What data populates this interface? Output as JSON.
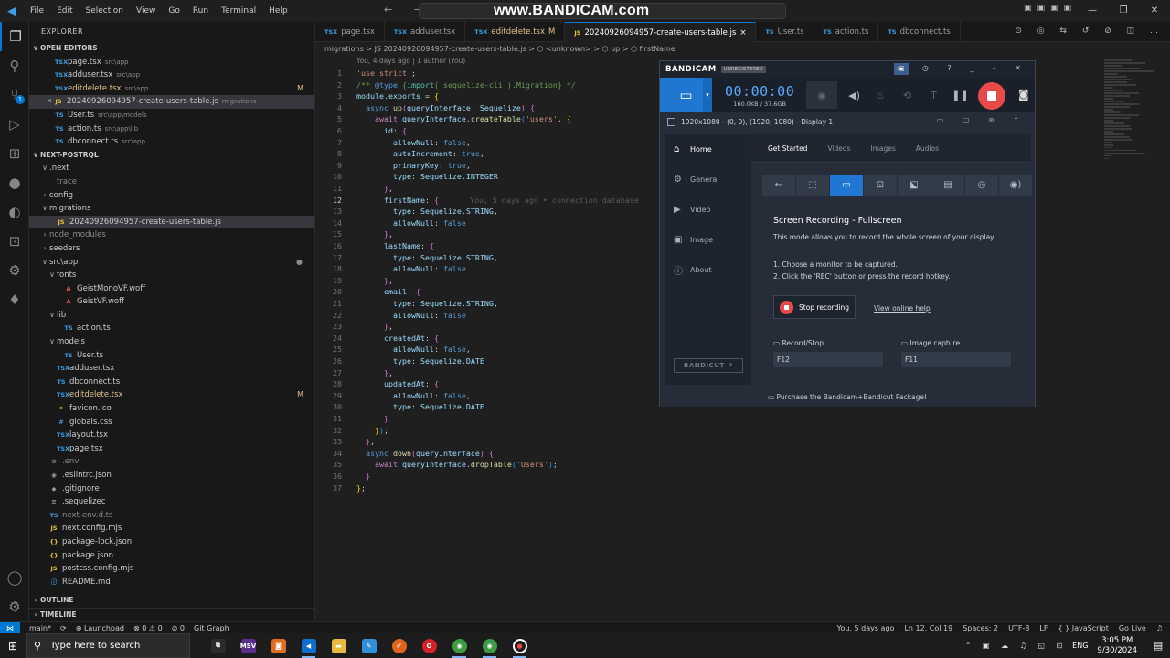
{
  "titlebar": {
    "menu": [
      "File",
      "Edit",
      "Selection",
      "View",
      "Go",
      "Run",
      "Terminal",
      "Help"
    ],
    "watermark": "www.BANDICAM.com"
  },
  "explorer": {
    "title": "EXPLORER",
    "open_editors_label": "OPEN EDITORS",
    "open_editors": [
      {
        "icon": "TSX",
        "name": "page.tsx",
        "desc": "src\\app",
        "modified": ""
      },
      {
        "icon": "TSX",
        "name": "adduser.tsx",
        "desc": "src\\app",
        "modified": ""
      },
      {
        "icon": "TSX",
        "name": "editdelete.tsx",
        "desc": "src\\app",
        "modified": "M"
      },
      {
        "icon": "JS",
        "name": "20240926094957-create-users-table.js",
        "desc": "migrations",
        "modified": ""
      },
      {
        "icon": "TS",
        "name": "User.ts",
        "desc": "src\\app\\models",
        "modified": ""
      },
      {
        "icon": "TS",
        "name": "action.ts",
        "desc": "src\\app\\lib",
        "modified": ""
      },
      {
        "icon": "TS",
        "name": "dbconnect.ts",
        "desc": "src\\app",
        "modified": ""
      }
    ],
    "project_label": "NEXT-POSTRQL",
    "tree": [
      {
        "name": ".next",
        "twisty": "v",
        "icon": "",
        "depth": 1
      },
      {
        "name": "trace",
        "twisty": "",
        "icon": "",
        "depth": 2
      },
      {
        "name": "config",
        "twisty": ">",
        "icon": "",
        "depth": 1
      },
      {
        "name": "migrations",
        "twisty": "v",
        "icon": "",
        "depth": 1
      },
      {
        "name": "20240926094957-create-users-table.js",
        "twisty": "",
        "icon": "JS",
        "depth": 2
      },
      {
        "name": "node_modules",
        "twisty": ">",
        "icon": "",
        "depth": 1
      },
      {
        "name": "seeders",
        "twisty": ">",
        "icon": "",
        "depth": 1
      },
      {
        "name": "src\\app",
        "twisty": "v",
        "icon": "",
        "depth": 1
      },
      {
        "name": "fonts",
        "twisty": "v",
        "icon": "",
        "depth": 2
      },
      {
        "name": "GeistMonoVF.woff",
        "twisty": "",
        "icon": "A",
        "depth": 3
      },
      {
        "name": "GeistVF.woff",
        "twisty": "",
        "icon": "A",
        "depth": 3
      },
      {
        "name": "lib",
        "twisty": "v",
        "icon": "",
        "depth": 2
      },
      {
        "name": "action.ts",
        "twisty": "",
        "icon": "TS",
        "depth": 3
      },
      {
        "name": "models",
        "twisty": "v",
        "icon": "",
        "depth": 2
      },
      {
        "name": "User.ts",
        "twisty": "",
        "icon": "TS",
        "depth": 3
      },
      {
        "name": "adduser.tsx",
        "twisty": "",
        "icon": "TSX",
        "depth": 2
      },
      {
        "name": "dbconnect.ts",
        "twisty": "",
        "icon": "TS",
        "depth": 2
      },
      {
        "name": "editdelete.tsx",
        "twisty": "",
        "icon": "TSX",
        "depth": 2
      },
      {
        "name": "favicon.ico",
        "twisty": "",
        "icon": "*",
        "depth": 2
      },
      {
        "name": "globals.css",
        "twisty": "",
        "icon": "#",
        "depth": 2
      },
      {
        "name": "layout.tsx",
        "twisty": "",
        "icon": "TSX",
        "depth": 2
      },
      {
        "name": "page.tsx",
        "twisty": "",
        "icon": "TSX",
        "depth": 2
      },
      {
        "name": ".env",
        "twisty": "",
        "icon": "⚙",
        "depth": 1
      },
      {
        "name": ".eslintrc.json",
        "twisty": "",
        "icon": "◉",
        "depth": 1
      },
      {
        "name": ".gitignore",
        "twisty": "",
        "icon": "◆",
        "depth": 1
      },
      {
        "name": ".sequelizec",
        "twisty": "",
        "icon": "≡",
        "depth": 1
      },
      {
        "name": "next-env.d.ts",
        "twisty": "",
        "icon": "TS",
        "depth": 1
      },
      {
        "name": "next.config.mjs",
        "twisty": "",
        "icon": "JS",
        "depth": 1
      },
      {
        "name": "package-lock.json",
        "twisty": "",
        "icon": "{}",
        "depth": 1
      },
      {
        "name": "package.json",
        "twisty": "",
        "icon": "{}",
        "depth": 1
      },
      {
        "name": "postcss.config.mjs",
        "twisty": "",
        "icon": "JS",
        "depth": 1
      },
      {
        "name": "README.md",
        "twisty": "",
        "icon": "ⓘ",
        "depth": 1
      }
    ],
    "outline_label": "OUTLINE",
    "timeline_label": "TIMELINE"
  },
  "tabs": [
    {
      "icon": "TSX",
      "label": "page.tsx",
      "mod": ""
    },
    {
      "icon": "TSX",
      "label": "adduser.tsx",
      "mod": ""
    },
    {
      "icon": "TSX",
      "label": "editdelete.tsx",
      "mod": "M"
    },
    {
      "icon": "JS",
      "label": "20240926094957-create-users-table.js",
      "mod": "×"
    },
    {
      "icon": "TS",
      "label": "User.ts",
      "mod": ""
    },
    {
      "icon": "TS",
      "label": "action.ts",
      "mod": ""
    },
    {
      "icon": "TS",
      "label": "dbconnect.ts",
      "mod": ""
    }
  ],
  "breadcrumb": "migrations  >  JS 20240926094957-create-users-table.js  >  ⬡ <unknown>  >  ⬡ up  >  ⬡ firstName",
  "editor": {
    "blame_header": "You, 4 days ago | 1 author (You)",
    "inline_blame": "You, 5 days ago • connection database",
    "current_line": 12,
    "lines": [
      [
        [
          "s",
          "'use strict'"
        ],
        [
          "p",
          ";"
        ]
      ],
      [
        [
          "cm",
          "/** "
        ],
        [
          "k",
          "@type"
        ],
        [
          "cm",
          " {"
        ],
        [
          "t",
          "import"
        ],
        [
          "cm",
          "('sequelize-cli').Migration} */"
        ]
      ],
      [
        [
          "v",
          "module"
        ],
        [
          "p",
          "."
        ],
        [
          "v",
          "exports"
        ],
        [
          "p",
          " = "
        ],
        [
          "b1",
          "{"
        ]
      ],
      [
        [
          "p",
          "  "
        ],
        [
          "k",
          "async"
        ],
        [
          "p",
          " "
        ],
        [
          "f",
          "up"
        ],
        [
          "b2",
          "("
        ],
        [
          "v",
          "queryInterface"
        ],
        [
          "p",
          ", "
        ],
        [
          "v",
          "Sequelize"
        ],
        [
          "b2",
          ")"
        ],
        [
          "p",
          " "
        ],
        [
          "b2",
          "{"
        ]
      ],
      [
        [
          "p",
          "    "
        ],
        [
          "kc",
          "await"
        ],
        [
          "p",
          " "
        ],
        [
          "v",
          "queryInterface"
        ],
        [
          "p",
          "."
        ],
        [
          "f",
          "createTable"
        ],
        [
          "b3",
          "("
        ],
        [
          "s",
          "'users'"
        ],
        [
          "p",
          ", "
        ],
        [
          "b1",
          "{"
        ]
      ],
      [
        [
          "p",
          "      "
        ],
        [
          "v",
          "id"
        ],
        [
          "p",
          ": "
        ],
        [
          "b2",
          "{"
        ]
      ],
      [
        [
          "p",
          "        "
        ],
        [
          "v",
          "allowNull"
        ],
        [
          "p",
          ": "
        ],
        [
          "k",
          "false"
        ],
        [
          "p",
          ","
        ]
      ],
      [
        [
          "p",
          "        "
        ],
        [
          "v",
          "autoIncrement"
        ],
        [
          "p",
          ": "
        ],
        [
          "k",
          "true"
        ],
        [
          "p",
          ","
        ]
      ],
      [
        [
          "p",
          "        "
        ],
        [
          "v",
          "primaryKey"
        ],
        [
          "p",
          ": "
        ],
        [
          "k",
          "true"
        ],
        [
          "p",
          ","
        ]
      ],
      [
        [
          "p",
          "        "
        ],
        [
          "v",
          "type"
        ],
        [
          "p",
          ": "
        ],
        [
          "v",
          "Sequelize"
        ],
        [
          "p",
          "."
        ],
        [
          "v",
          "INTEGER"
        ]
      ],
      [
        [
          "p",
          "      "
        ],
        [
          "b2",
          "}"
        ],
        [
          "p",
          ","
        ]
      ],
      [
        [
          "p",
          "      "
        ],
        [
          "v",
          "firstName"
        ],
        [
          "p",
          ": "
        ],
        [
          "b2",
          "{"
        ]
      ],
      [
        [
          "p",
          "        "
        ],
        [
          "v",
          "type"
        ],
        [
          "p",
          ": "
        ],
        [
          "v",
          "Sequelize"
        ],
        [
          "p",
          "."
        ],
        [
          "v",
          "STRING"
        ],
        [
          "p",
          ","
        ]
      ],
      [
        [
          "p",
          "        "
        ],
        [
          "v",
          "allowNull"
        ],
        [
          "p",
          ": "
        ],
        [
          "k",
          "false"
        ]
      ],
      [
        [
          "p",
          "      "
        ],
        [
          "b2",
          "}"
        ],
        [
          "p",
          ","
        ]
      ],
      [
        [
          "p",
          "      "
        ],
        [
          "v",
          "lastName"
        ],
        [
          "p",
          ": "
        ],
        [
          "b2",
          "{"
        ]
      ],
      [
        [
          "p",
          "        "
        ],
        [
          "v",
          "type"
        ],
        [
          "p",
          ": "
        ],
        [
          "v",
          "Sequelize"
        ],
        [
          "p",
          "."
        ],
        [
          "v",
          "STRING"
        ],
        [
          "p",
          ","
        ]
      ],
      [
        [
          "p",
          "        "
        ],
        [
          "v",
          "allowNull"
        ],
        [
          "p",
          ": "
        ],
        [
          "k",
          "false"
        ]
      ],
      [
        [
          "p",
          "      "
        ],
        [
          "b2",
          "}"
        ],
        [
          "p",
          ","
        ]
      ],
      [
        [
          "p",
          "      "
        ],
        [
          "v",
          "email"
        ],
        [
          "p",
          ": "
        ],
        [
          "b2",
          "{"
        ]
      ],
      [
        [
          "p",
          "        "
        ],
        [
          "v",
          "type"
        ],
        [
          "p",
          ": "
        ],
        [
          "v",
          "Sequelize"
        ],
        [
          "p",
          "."
        ],
        [
          "v",
          "STRING"
        ],
        [
          "p",
          ","
        ]
      ],
      [
        [
          "p",
          "        "
        ],
        [
          "v",
          "allowNull"
        ],
        [
          "p",
          ": "
        ],
        [
          "k",
          "false"
        ]
      ],
      [
        [
          "p",
          "      "
        ],
        [
          "b2",
          "}"
        ],
        [
          "p",
          ","
        ]
      ],
      [
        [
          "p",
          "      "
        ],
        [
          "v",
          "createdAt"
        ],
        [
          "p",
          ": "
        ],
        [
          "b2",
          "{"
        ]
      ],
      [
        [
          "p",
          "        "
        ],
        [
          "v",
          "allowNull"
        ],
        [
          "p",
          ": "
        ],
        [
          "k",
          "false"
        ],
        [
          "p",
          ","
        ]
      ],
      [
        [
          "p",
          "        "
        ],
        [
          "v",
          "type"
        ],
        [
          "p",
          ": "
        ],
        [
          "v",
          "Sequelize"
        ],
        [
          "p",
          "."
        ],
        [
          "v",
          "DATE"
        ]
      ],
      [
        [
          "p",
          "      "
        ],
        [
          "b2",
          "}"
        ],
        [
          "p",
          ","
        ]
      ],
      [
        [
          "p",
          "      "
        ],
        [
          "v",
          "updatedAt"
        ],
        [
          "p",
          ": "
        ],
        [
          "b2",
          "{"
        ]
      ],
      [
        [
          "p",
          "        "
        ],
        [
          "v",
          "allowNull"
        ],
        [
          "p",
          ": "
        ],
        [
          "k",
          "false"
        ],
        [
          "p",
          ","
        ]
      ],
      [
        [
          "p",
          "        "
        ],
        [
          "v",
          "type"
        ],
        [
          "p",
          ": "
        ],
        [
          "v",
          "Sequelize"
        ],
        [
          "p",
          "."
        ],
        [
          "v",
          "DATE"
        ]
      ],
      [
        [
          "p",
          "      "
        ],
        [
          "b2",
          "}"
        ]
      ],
      [
        [
          "p",
          "    "
        ],
        [
          "b1",
          "}"
        ],
        [
          "b3",
          ")"
        ],
        [
          "p",
          ";"
        ]
      ],
      [
        [
          "p",
          "  "
        ],
        [
          "b2",
          "}"
        ],
        [
          "p",
          ","
        ]
      ],
      [
        [
          "p",
          "  "
        ],
        [
          "k",
          "async"
        ],
        [
          "p",
          " "
        ],
        [
          "f",
          "down"
        ],
        [
          "b2",
          "("
        ],
        [
          "v",
          "queryInterface"
        ],
        [
          "b2",
          ")"
        ],
        [
          "p",
          " "
        ],
        [
          "b2",
          "{"
        ]
      ],
      [
        [
          "p",
          "    "
        ],
        [
          "kc",
          "await"
        ],
        [
          "p",
          " "
        ],
        [
          "v",
          "queryInterface"
        ],
        [
          "p",
          "."
        ],
        [
          "f",
          "dropTable"
        ],
        [
          "b3",
          "("
        ],
        [
          "s",
          "'Users'"
        ],
        [
          "b3",
          ")"
        ],
        [
          "p",
          ";"
        ]
      ],
      [
        [
          "p",
          "  "
        ],
        [
          "b2",
          "}"
        ]
      ],
      [
        [
          "b1",
          "}"
        ],
        [
          "p",
          ";"
        ]
      ]
    ]
  },
  "statusbar": {
    "left": [
      "main*",
      "⟳",
      "⊕ Launchpad",
      "⊗ 0 ⚠ 0",
      "⊘ 0",
      "Git Graph"
    ],
    "right": [
      "You, 5 days ago",
      "Ln 12, Col 19",
      "Spaces: 2",
      "UTF-8",
      "LF",
      "{ } JavaScript",
      "Go Live"
    ]
  },
  "taskbar": {
    "search_placeholder": "Type here to search",
    "apps": [
      "explorer-view",
      "msv",
      "app-orange",
      "vscode",
      "file-explorer",
      "app-blue",
      "app-orange-circle",
      "opera",
      "chrome",
      "chrome-2",
      "bandicam"
    ],
    "lang": "ENG",
    "time": "3:05 PM",
    "date": "9/30/2024",
    "notifications": "3"
  },
  "bandicam": {
    "logo": "BANDICAM",
    "unregistered": "UNREGISTERED",
    "timer": "00:00:00",
    "size": "160.0KB / 37.6GB",
    "display": "1920x1080 - (0, 0), (1920, 1080) - Display 1",
    "nav": [
      "Home",
      "General",
      "Video",
      "Image",
      "About"
    ],
    "tabs": [
      "Get Started",
      "Videos",
      "Images",
      "Audios"
    ],
    "heading": "Screen Recording - Fullscreen",
    "desc": "This mode allows you to record the whole screen of your display.",
    "step1": "1. Choose a monitor to be captured.",
    "step2": "2. Click the 'REC' button or press the record hotkey.",
    "stop_label": "Stop recording",
    "help_link": "View online help",
    "hotkey1_label": "Record/Stop",
    "hotkey1": "F12",
    "hotkey2_label": "Image capture",
    "hotkey2": "F11",
    "bandicut": "BANDICUT ↗",
    "footer": "Purchase the Bandicam+Bandicut Package!"
  }
}
